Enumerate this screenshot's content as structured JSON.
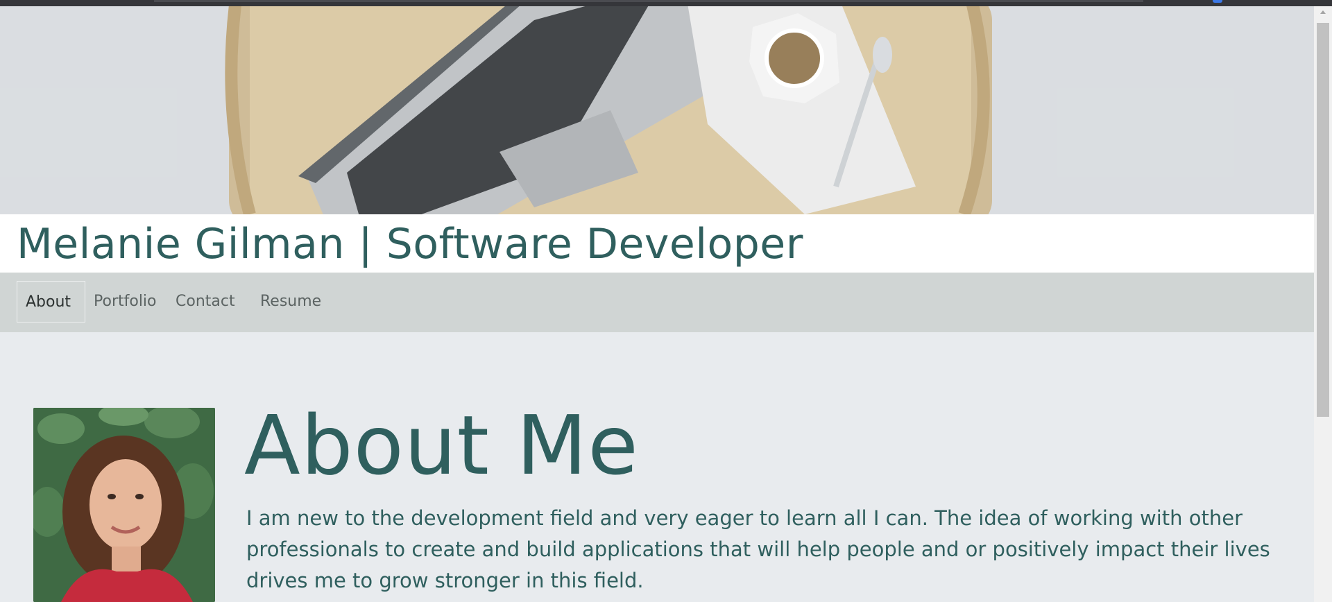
{
  "site": {
    "title": "Melanie Gilman | Software Developer"
  },
  "nav": {
    "items": [
      {
        "label": "About",
        "active": true
      },
      {
        "label": "Portfolio",
        "active": false
      },
      {
        "label": "Contact",
        "active": false
      },
      {
        "label": "Resume",
        "active": false
      }
    ]
  },
  "about": {
    "heading": "About Me",
    "body": "I am new to the development field and very eager to learn all I can. The idea of working with other professionals to create and build applications that will help people and or positively impact their lives drives me to grow stronger in this field."
  },
  "colors": {
    "accent": "#2f5f5e",
    "nav_bg": "#d0d5d4",
    "page_bg": "#e8ebee"
  }
}
